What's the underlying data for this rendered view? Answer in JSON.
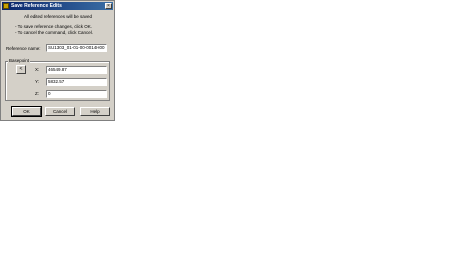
{
  "dialog": {
    "title": "Save Reference Edits",
    "close_glyph": "×",
    "message_line1": "All edited references will be saved",
    "message_line2": "- To save reference changes, click OK.",
    "message_line3": "- To cancel the command, click Cancel."
  },
  "reference": {
    "label": "Reference name:",
    "value": "SU1303_01-01-00-0014H00"
  },
  "basepoint": {
    "group_label": "Basepoint",
    "pick_glyph": "<",
    "x_label": "X:",
    "x_value": "46549.87",
    "y_label": "Y:",
    "y_value": "5832.57",
    "z_label": "Z:",
    "z_value": "0"
  },
  "buttons": {
    "ok": "OK",
    "cancel": "Cancel",
    "help": "Help"
  }
}
